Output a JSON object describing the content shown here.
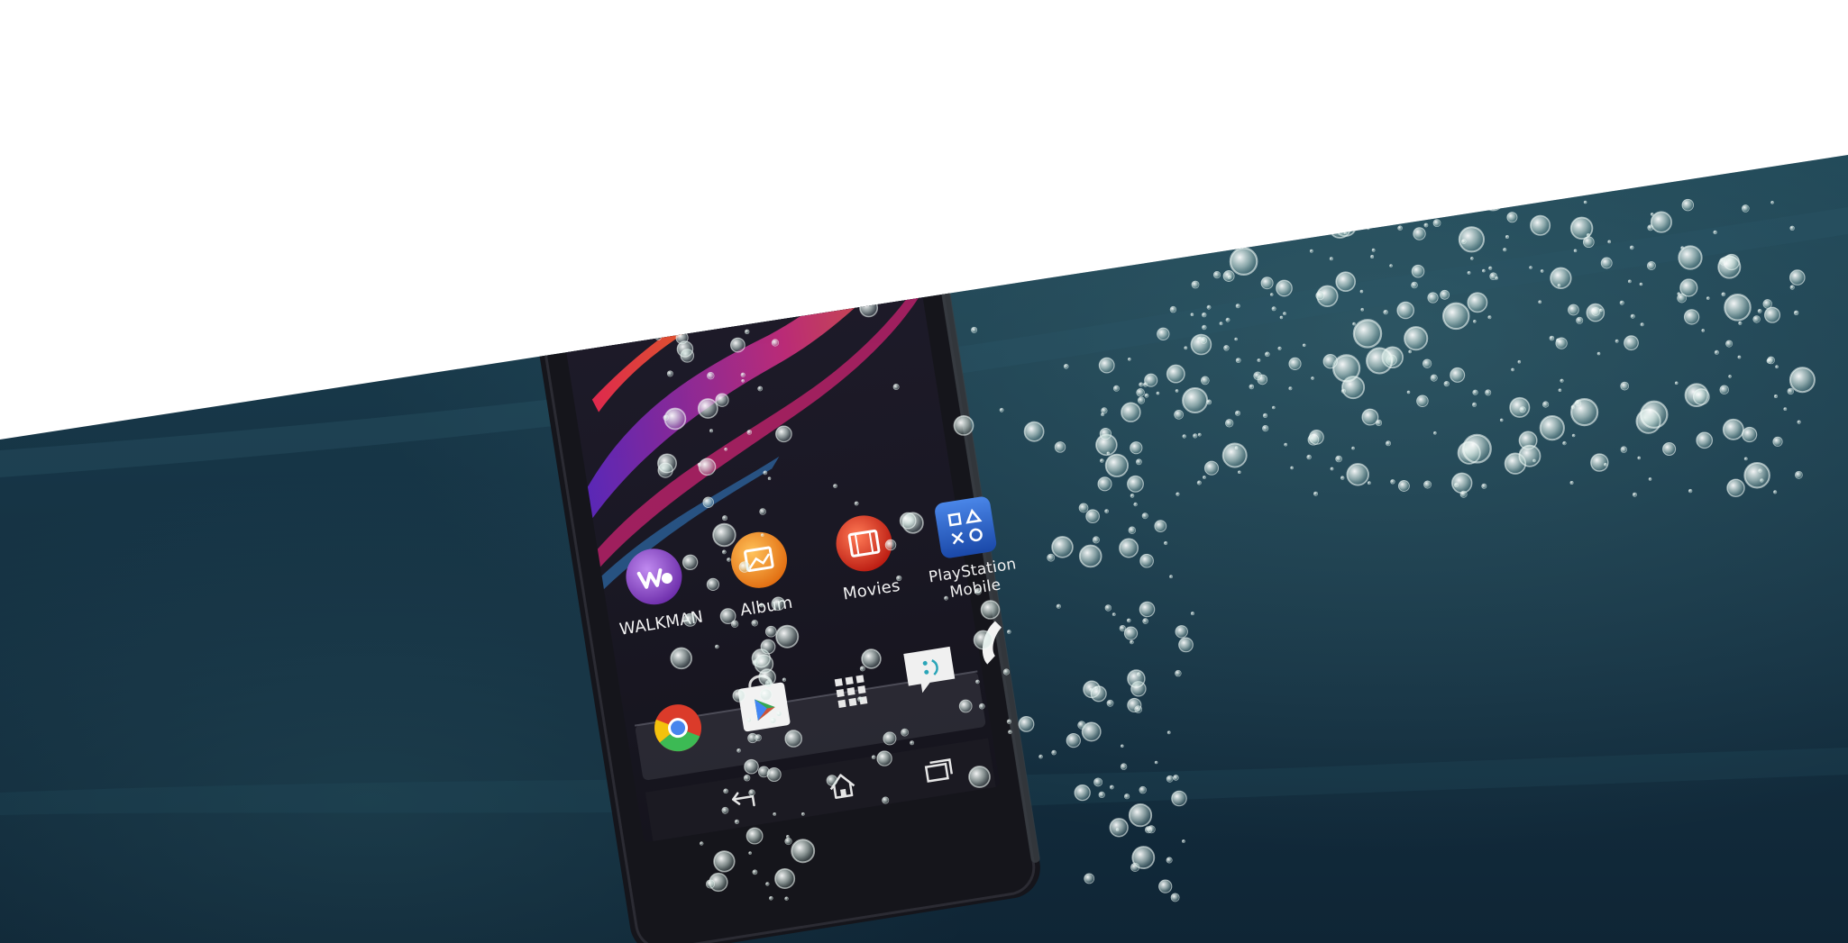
{
  "scene": {
    "description_colors": {
      "water_dark": "#10283a",
      "water_mid": "#1f4455",
      "water_light": "#3d6a77",
      "phone_body": "#17171d",
      "phone_bezel": "#0c0c10",
      "bubble": "#eaf4f1"
    }
  },
  "phone": {
    "apps": [
      {
        "label": "WALKMAN",
        "icon": "walkman-icon",
        "color": "#8c4bc7"
      },
      {
        "label": "Album",
        "icon": "album-icon",
        "color": "#f08a1e"
      },
      {
        "label": "Movies",
        "icon": "movies-icon",
        "color": "#d8311e"
      },
      {
        "label": "PlayStation",
        "label2": "Mobile",
        "icon": "playstation-mobile-icon",
        "color": "#2a63c6"
      }
    ],
    "dock": [
      {
        "icon": "chrome-icon"
      },
      {
        "icon": "play-store-icon"
      },
      {
        "icon": "app-drawer-icon"
      },
      {
        "icon": "messaging-icon"
      },
      {
        "icon": "phone-call-icon"
      }
    ],
    "nav": [
      {
        "icon": "back-icon"
      },
      {
        "icon": "home-icon"
      },
      {
        "icon": "recent-apps-icon"
      }
    ]
  }
}
